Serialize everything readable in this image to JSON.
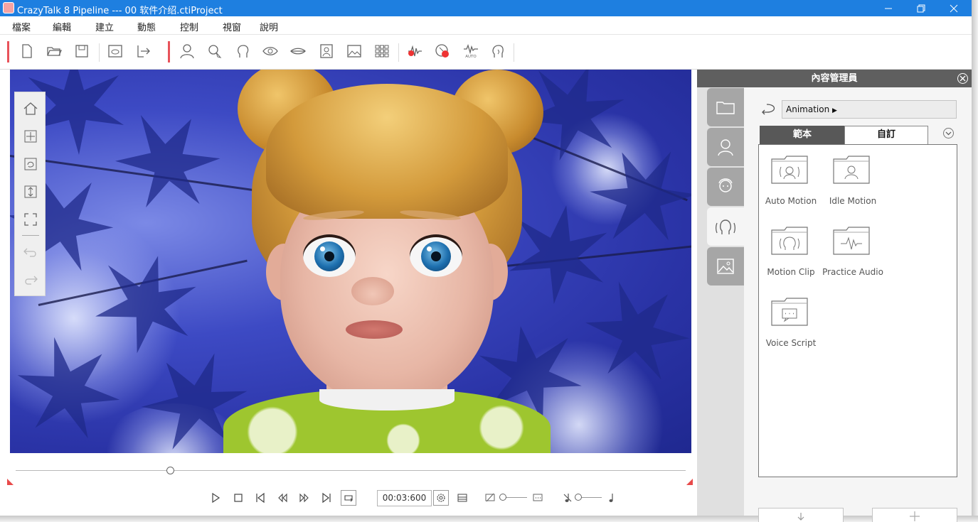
{
  "window": {
    "title": "CrazyTalk 8 Pipeline --- 00 软件介绍.ctiProject"
  },
  "menu": {
    "items": [
      "檔案",
      "編輯",
      "建立",
      "動態",
      "控制",
      "視窗",
      "說明"
    ]
  },
  "toolbar": {
    "icons": [
      "new-file-icon",
      "open-folder-icon",
      "save-icon",
      "preview-icon",
      "export-icon",
      "actor-icon",
      "face-fitting-icon",
      "head-icon",
      "eye-icon",
      "mouth-icon",
      "portrait-icon",
      "background-image-icon",
      "grid-icon",
      "voice-record-icon",
      "record-motion-icon",
      "auto-motion-icon",
      "talking-head-icon"
    ]
  },
  "navigation": {
    "icons": [
      "home-icon",
      "move-icon",
      "rotate-icon",
      "zoom-icon",
      "fit-view-icon",
      "undo-icon",
      "redo-icon"
    ]
  },
  "playback": {
    "time": "00:03:600",
    "timeline_position": 0.23
  },
  "content_manager": {
    "title": "內容管理員",
    "path": "Animation",
    "tabs": {
      "template": "範本",
      "custom": "自訂"
    },
    "side_tabs": [
      "folder-icon",
      "actor-icon",
      "face-icon",
      "animation-icon",
      "scene-icon"
    ],
    "items": [
      {
        "label": "Auto Motion",
        "icon": "auto-motion-folder-icon"
      },
      {
        "label": "Idle Motion",
        "icon": "idle-motion-folder-icon"
      },
      {
        "label": "Motion Clip",
        "icon": "motion-clip-folder-icon"
      },
      {
        "label": "Practice Audio",
        "icon": "practice-audio-folder-icon"
      },
      {
        "label": "Voice Script",
        "icon": "voice-script-folder-icon"
      }
    ]
  },
  "colors": {
    "titlebar": "#1e7fe0",
    "accent_red": "#e8535a",
    "panel_header": "#5f5f5f"
  }
}
